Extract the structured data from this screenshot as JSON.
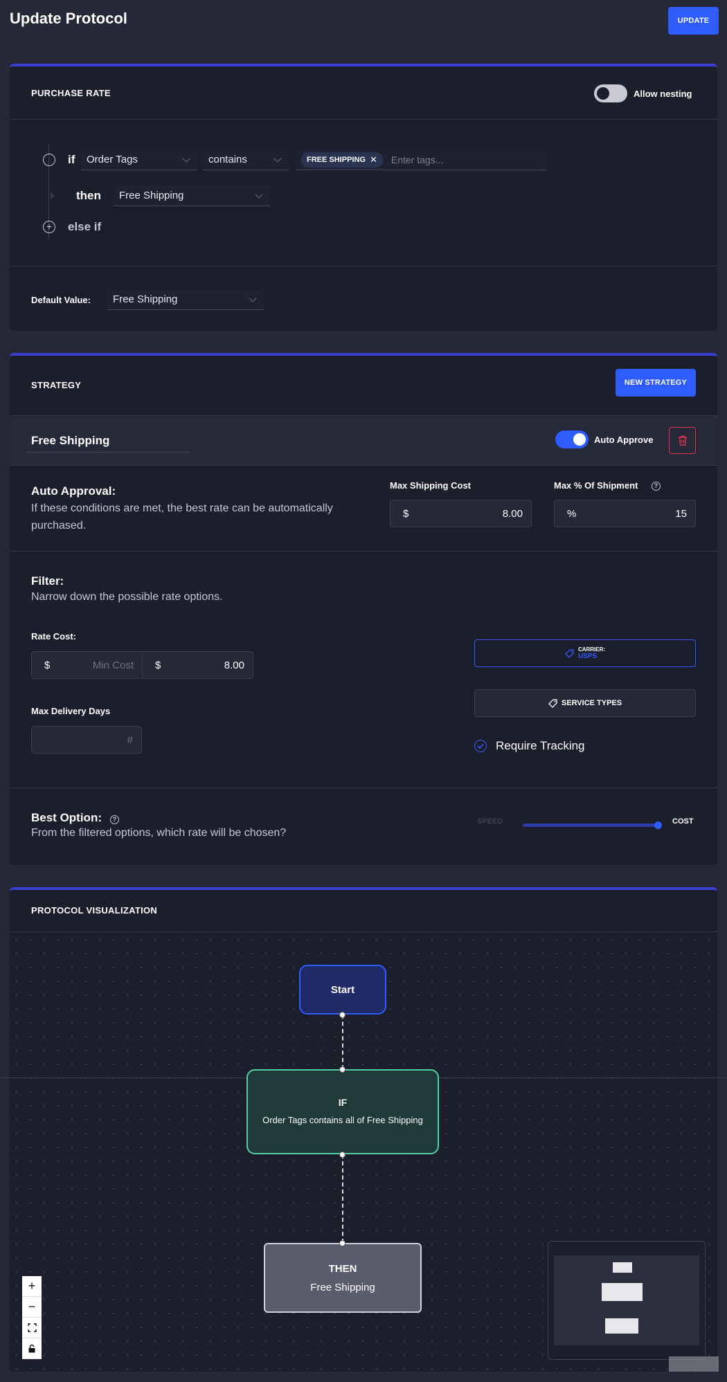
{
  "header": {
    "title": "Update Protocol",
    "update_label": "UPDATE"
  },
  "purchase_rate": {
    "title": "PURCHASE RATE",
    "allow_nesting_label": "Allow nesting",
    "allow_nesting_on": false,
    "if_label": "if",
    "field": "Order Tags",
    "operator": "contains",
    "tag": "FREE SHIPPING",
    "tag_placeholder": "Enter tags...",
    "then_label": "then",
    "then_value": "Free Shipping",
    "else_if_label": "else if",
    "default_label": "Default Value:",
    "default_value": "Free Shipping"
  },
  "strategy": {
    "title": "STRATEGY",
    "new_strategy_label": "NEW STRATEGY",
    "name": "Free Shipping",
    "auto_approve_label": "Auto Approve",
    "auto_approve_on": true,
    "auto_approval_title": "Auto Approval:",
    "auto_approval_desc": "If these conditions are met, the best rate can be automatically purchased.",
    "max_shipping_cost_label": "Max Shipping Cost",
    "max_shipping_cost_prefix": "$",
    "max_shipping_cost": "8.00",
    "max_pct_label": "Max % Of Shipment",
    "max_pct_prefix": "%",
    "max_pct": "15",
    "filter_title": "Filter:",
    "filter_desc": "Narrow down the possible rate options.",
    "rate_cost_label": "Rate Cost:",
    "min_prefix": "$",
    "min_placeholder": "Min Cost",
    "max_prefix": "$",
    "max_value": "8.00",
    "carrier_label": "CARRIER:",
    "carrier_value": "USPS",
    "service_types_label": "SERVICE TYPES",
    "max_delivery_label": "Max Delivery Days",
    "max_delivery_placeholder": "#",
    "require_tracking_label": "Require Tracking",
    "require_tracking_on": true,
    "best_option_title": "Best Option:",
    "best_option_desc": "From the filtered options, which rate will be chosen?",
    "speed_label": "SPEED",
    "cost_label": "COST",
    "slider_value": 1.0
  },
  "visualization": {
    "title": "PROTOCOL VISUALIZATION",
    "start_label": "Start",
    "if_title": "IF",
    "if_desc": "Order Tags contains all of Free Shipping",
    "then_title": "THEN",
    "then_desc": "Free Shipping",
    "controls": {
      "zoom_in": "+",
      "zoom_out": "−",
      "fit": "⛶",
      "lock": "🔒"
    }
  },
  "colors": {
    "accent": "#2f5cff",
    "card": "#1d1e2b",
    "background": "#262837",
    "if_node": "#4fd1a5",
    "danger": "#e0334f"
  }
}
